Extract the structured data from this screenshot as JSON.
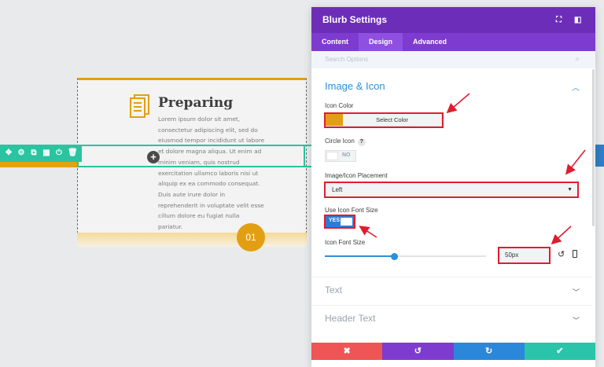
{
  "blurb": {
    "title": "Preparing",
    "body": "Lorem ipsum dolor sit amet, consectetur adipiscing elit, sed do eiusmod tempor incididunt ut labore et dolore magna aliqua. Ut enim ad minim veniam, quis nostrud exercitation ullamco laboris nisi ut aliquip ex ea commodo consequat. Duis aute irure dolor in reprehenderit in voluptate velit esse cillum dolore eu fugiat nulla pariatur.",
    "badge": "01",
    "accent_color": "#e39f12"
  },
  "row_toolbar": {
    "icons": [
      "move-icon",
      "gear-icon",
      "duplicate-icon",
      "columns-icon",
      "power-icon",
      "trash-icon"
    ],
    "add_symbol": "+"
  },
  "panel": {
    "title": "Blurb Settings",
    "tabs": [
      "Content",
      "Design",
      "Advanced"
    ],
    "active_tab": "Design",
    "search_placeholder": "Search Options",
    "section_title": "Image & Icon",
    "icon_color": {
      "label": "Icon Color",
      "button_label": "Select Color",
      "value": "#e39f12"
    },
    "circle_icon": {
      "label": "Circle Icon",
      "help": "?",
      "state": "NO"
    },
    "placement": {
      "label": "Image/Icon Placement",
      "value": "Left"
    },
    "use_icon_font_size": {
      "label": "Use Icon Font Size",
      "state": "YES"
    },
    "icon_font_size": {
      "label": "Icon Font Size",
      "value": "50px",
      "slider_fraction": 0.43
    },
    "collapsed_sections": [
      "Text",
      "Header Text"
    ],
    "footer": {
      "close": "✖",
      "undo": "↺",
      "redo": "↻",
      "save": "✔"
    }
  },
  "colors": {
    "header_purple": "#6c2eb9",
    "tab_purple": "#7e3bd0",
    "teal": "#2bc3a0",
    "blue": "#2e8fd4",
    "highlight_red": "#e01d30"
  }
}
